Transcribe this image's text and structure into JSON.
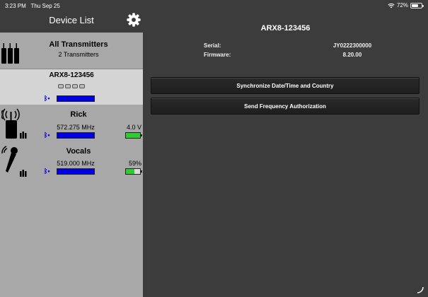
{
  "status": {
    "time": "3:23 PM",
    "date": "Thu Sep 25",
    "battery": "72%",
    "battery_level": 0.72
  },
  "sidebar": {
    "title": "Device List",
    "all": {
      "title": "All Transmitters",
      "subtitle": "2 Transmitters"
    },
    "selected": {
      "name": "ARX8-123456"
    },
    "devices": [
      {
        "name": "Rick",
        "freq": "572.275 MHz",
        "battery_label": "4.0 V",
        "battery_level": 1.0,
        "icon": "bodypack-transmitter-icon"
      },
      {
        "name": "Vocals",
        "freq": "519.000 MHz",
        "battery_label": "59%",
        "battery_level": 0.59,
        "icon": "handheld-mic-icon"
      }
    ]
  },
  "main": {
    "title": "ARX8-123456",
    "serial_label": "Serial:",
    "serial_value": "JY0222300000",
    "firmware_label": "Firmware:",
    "firmware_value": "8.20.00",
    "btn_sync": "Synchronize Date/Time and Country",
    "btn_freq": "Send Frequency Authorization"
  },
  "colors": {
    "rf_bar": "#0000e6",
    "battery_green": "#2ecc2e",
    "bluetooth": "#0000e6"
  }
}
